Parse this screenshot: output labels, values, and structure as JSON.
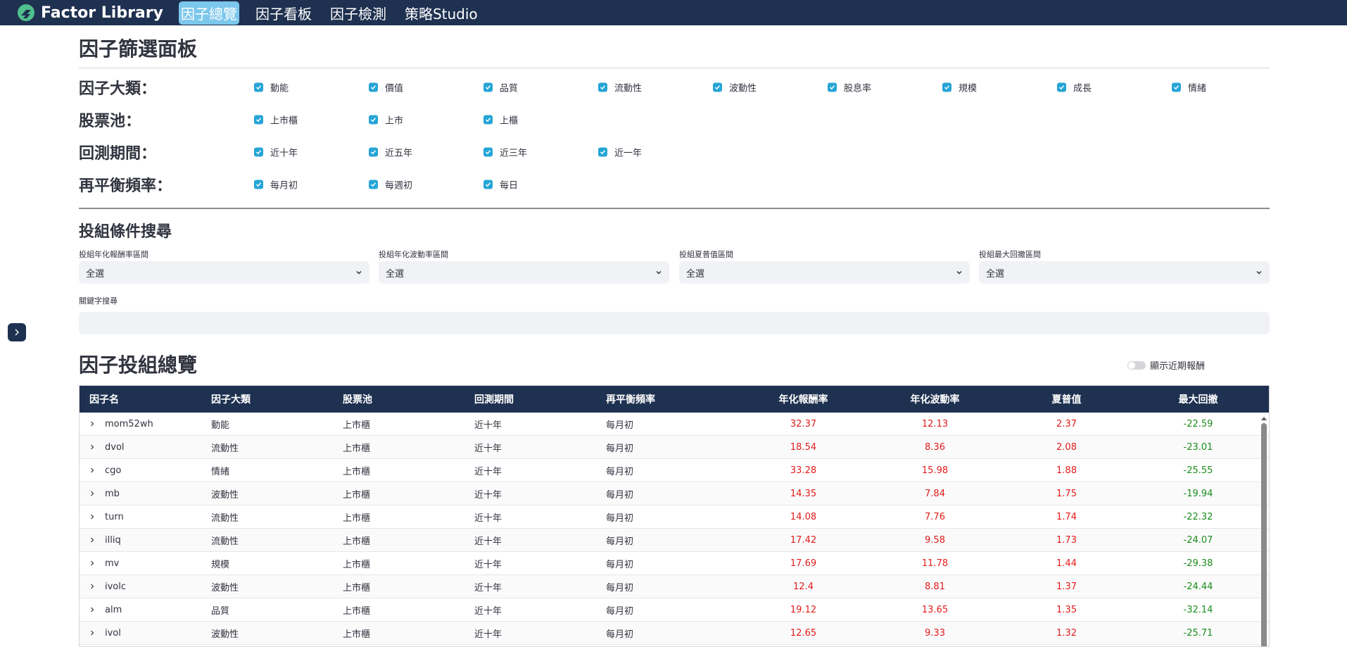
{
  "brand": {
    "name": "Factor Library"
  },
  "nav": [
    "因子總覽",
    "因子看板",
    "因子檢測",
    "策略Studio"
  ],
  "filter_panel": {
    "title": "因子篩選面板",
    "rows": [
      {
        "label": "因子大類：",
        "options": [
          "動能",
          "價值",
          "品質",
          "流動性",
          "波動性",
          "股息率",
          "規模",
          "成長",
          "情緒"
        ]
      },
      {
        "label": "股票池：",
        "options": [
          "上市櫃",
          "上市",
          "上櫃"
        ]
      },
      {
        "label": "回測期間：",
        "options": [
          "近十年",
          "近五年",
          "近三年",
          "近一年"
        ]
      },
      {
        "label": "再平衡頻率：",
        "options": [
          "每月初",
          "每週初",
          "每日"
        ]
      }
    ]
  },
  "search_panel": {
    "title": "投組條件搜尋",
    "selects": [
      {
        "label": "投組年化報酬率區間",
        "value": "全選"
      },
      {
        "label": "投組年化波動率區間",
        "value": "全選"
      },
      {
        "label": "投組夏普值區間",
        "value": "全選"
      },
      {
        "label": "投組最大回撤區間",
        "value": "全選"
      }
    ],
    "keyword_label": "關鍵字搜尋",
    "keyword_value": ""
  },
  "overview": {
    "title": "因子投組總覽",
    "toggle_label": "顯示近期報酬",
    "toggle_on": false,
    "columns": [
      "因子名",
      "因子大類",
      "股票池",
      "回測期間",
      "再平衡頻率",
      "年化報酬率",
      "年化波動率",
      "夏普值",
      "最大回撤"
    ],
    "rows": [
      [
        "mom52wh",
        "動能",
        "上市櫃",
        "近十年",
        "每月初",
        "32.37",
        "12.13",
        "2.37",
        "-22.59"
      ],
      [
        "dvol",
        "流動性",
        "上市櫃",
        "近十年",
        "每月初",
        "18.54",
        "8.36",
        "2.08",
        "-23.01"
      ],
      [
        "cgo",
        "情緒",
        "上市櫃",
        "近十年",
        "每月初",
        "33.28",
        "15.98",
        "1.88",
        "-25.55"
      ],
      [
        "mb",
        "波動性",
        "上市櫃",
        "近十年",
        "每月初",
        "14.35",
        "7.84",
        "1.75",
        "-19.94"
      ],
      [
        "turn",
        "流動性",
        "上市櫃",
        "近十年",
        "每月初",
        "14.08",
        "7.76",
        "1.74",
        "-22.32"
      ],
      [
        "illiq",
        "流動性",
        "上市櫃",
        "近十年",
        "每月初",
        "17.42",
        "9.58",
        "1.73",
        "-24.07"
      ],
      [
        "mv",
        "規模",
        "上市櫃",
        "近十年",
        "每月初",
        "17.69",
        "11.78",
        "1.44",
        "-29.38"
      ],
      [
        "ivolc",
        "波動性",
        "上市櫃",
        "近十年",
        "每月初",
        "12.4",
        "8.81",
        "1.37",
        "-24.44"
      ],
      [
        "alm",
        "品質",
        "上市櫃",
        "近十年",
        "每月初",
        "19.12",
        "13.65",
        "1.35",
        "-32.14"
      ],
      [
        "ivol",
        "波動性",
        "上市櫃",
        "近十年",
        "每月初",
        "12.65",
        "9.33",
        "1.32",
        "-25.71"
      ]
    ]
  },
  "colors": {
    "navbar": "#1f3150",
    "active_tab": "#7cc7ec",
    "checkbox": "#26a5d6",
    "positive": "#e21b1b",
    "negative": "#1a8c1a"
  },
  "icons": [
    "logo-icon",
    "chevron-down-icon",
    "chevron-right-icon",
    "check-icon",
    "sidebar-expand-icon"
  ]
}
